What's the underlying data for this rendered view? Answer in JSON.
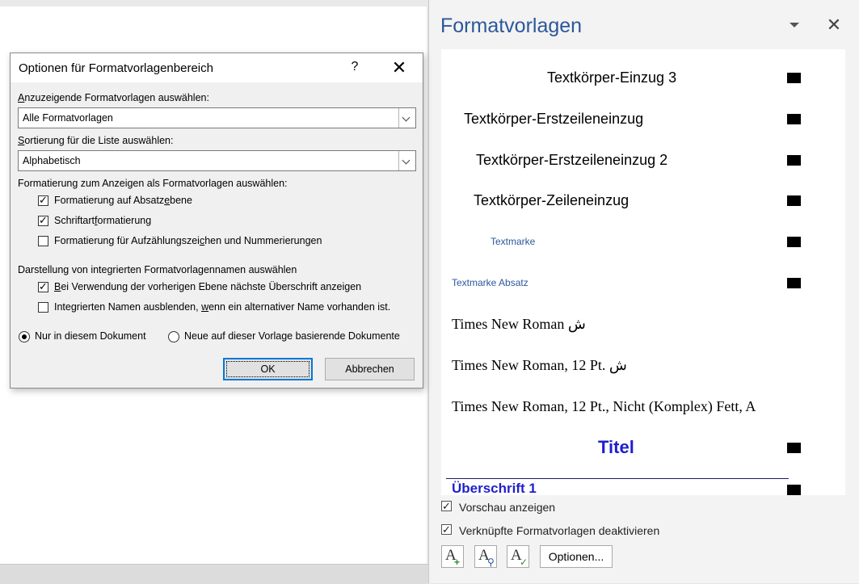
{
  "pane": {
    "title": "Formatvorlagen",
    "styles": [
      {
        "label": "Textkörper-Einzug 3",
        "has_mark": true
      },
      {
        "label": "Textkörper-Erstzeileneinzug",
        "has_mark": true
      },
      {
        "label": "Textkörper-Erstzeileneinzug 2",
        "has_mark": true
      },
      {
        "label": "Textkörper-Zeileneinzug",
        "has_mark": true
      },
      {
        "label": "Textmarke",
        "has_mark": true
      },
      {
        "label": "Textmarke Absatz",
        "has_mark": true
      },
      {
        "label": "Times New Roman ش",
        "has_mark": false
      },
      {
        "label": "Times New Roman, 12 Pt. ش",
        "has_mark": false
      },
      {
        "label": "Times New Roman, 12 Pt., Nicht (Komplex) Fett, A",
        "has_mark": false
      },
      {
        "label": "Titel",
        "has_mark": true
      },
      {
        "label": "Überschrift 1",
        "has_mark": true
      }
    ],
    "preview_label": "Vorschau anzeigen",
    "preview_checked": true,
    "linked_label": "Verknüpfte Formatvorlagen deaktivieren",
    "linked_checked": true,
    "options_label": "Optionen...",
    "icons": {
      "new_style": "new-style-icon",
      "style_inspector": "style-inspector-icon",
      "manage_styles": "manage-styles-icon"
    },
    "accent": "#2b579a",
    "heading_color": "#1f1fcc"
  },
  "dialog": {
    "title": "Optionen für Formatvorlagenbereich",
    "help": "?",
    "close": "✕",
    "select_styles_label_pre": "",
    "select_styles_label_u": "A",
    "select_styles_label_post": "nzuzeigende Formatvorlagen auswählen:",
    "select_styles_value": "Alle Formatvorlagen",
    "sort_label_u": "S",
    "sort_label_post": "ortierung für die Liste auswählen:",
    "sort_value": "Alphabetisch",
    "formatting_label": "Formatierung zum Anzeigen als Formatvorlagen auswählen:",
    "check_paragraph_pre": "Formatierung auf Absatz",
    "check_paragraph_u": "e",
    "check_paragraph_post": "bene",
    "check_paragraph_on": true,
    "check_font_pre": "Schriftart",
    "check_font_u": "f",
    "check_font_post": "ormatierung",
    "check_font_on": true,
    "check_bullets_pre": "Formatierung für Aufzählungszei",
    "check_bullets_u": "c",
    "check_bullets_post": "hen und Nummerierungen",
    "check_bullets_on": false,
    "builtin_label": "Darstellung von integrierten Formatvorlagennamen auswählen",
    "check_next_heading_u": "B",
    "check_next_heading_post": "ei Verwendung der vorherigen Ebene nächste Überschrift anzeigen",
    "check_next_heading_on": true,
    "check_hide_builtin_pre": "Integrierten Namen ausblenden, ",
    "check_hide_builtin_u": "w",
    "check_hide_builtin_post": "enn ein alternativer Name vorhanden ist.",
    "check_hide_builtin_on": false,
    "radio_doc_label": "Nur in diesem Dokument",
    "radio_doc_on": true,
    "radio_template_label": "Neue auf dieser Vorlage basierende Dokumente",
    "radio_template_on": false,
    "ok_label": "OK",
    "cancel_label": "Abbrechen"
  }
}
